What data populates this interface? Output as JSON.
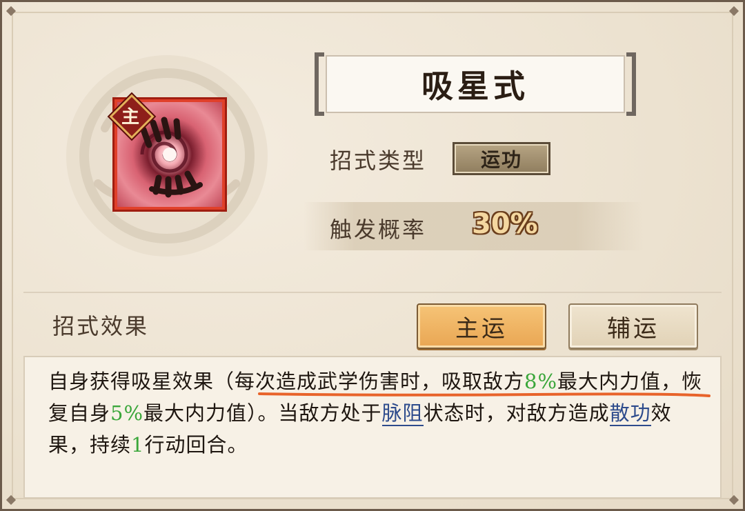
{
  "skill": {
    "name": "吸星式",
    "badge": "主",
    "icon": "vortex-palm-icon"
  },
  "type_row": {
    "label": "招式类型",
    "value": "运功"
  },
  "trigger_row": {
    "label": "触发概率",
    "value": "30%"
  },
  "effect_section": {
    "label": "招式效果",
    "tabs": [
      {
        "label": "主运",
        "active": true
      },
      {
        "label": "辅运",
        "active": false
      }
    ]
  },
  "effect": {
    "t1": "自身获得吸星效果（每次造成武学伤害时，吸取敌方",
    "v1": "8%",
    "t2": "最大内力值，恢复自身",
    "v2": "5%",
    "t3": "最大内力值）。当敌方处于",
    "link1": "脉阻",
    "t4": "状态时，对敌方造成",
    "link2": "散功",
    "t5": "效果，持续",
    "v3": "1",
    "t6": "行动回合。"
  },
  "colors": {
    "accent_orange": "#e9a653",
    "highlight_green": "#3aa63a",
    "link_blue": "#2d4b8c",
    "annotation_underline": "#e8632a"
  }
}
